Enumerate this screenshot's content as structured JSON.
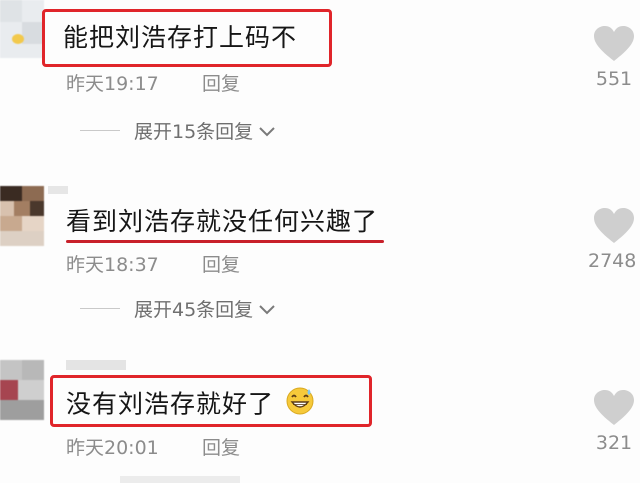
{
  "comments": [
    {
      "text": "能把刘浩存打上码不",
      "time": "昨天19:17",
      "reply_label": "回复",
      "expand_label": "展开15条回复",
      "likes": "551"
    },
    {
      "text": "看到刘浩存就没任何兴趣了",
      "time": "昨天18:37",
      "reply_label": "回复",
      "expand_label": "展开45条回复",
      "likes": "2748"
    },
    {
      "text": "没有刘浩存就好了",
      "time": "昨天20:01",
      "reply_label": "回复",
      "likes": "321"
    }
  ],
  "colors": {
    "highlight_red": "#e0252a",
    "meta_gray": "#8c8c8c",
    "heart_gray": "#cfcfcf"
  },
  "icons": {
    "like": "heart-icon",
    "expand": "chevron-down-icon",
    "emoji": "grinning-sweat-emoji"
  }
}
